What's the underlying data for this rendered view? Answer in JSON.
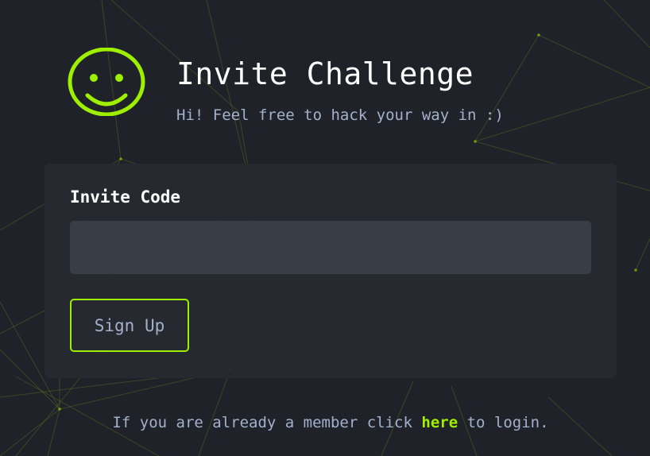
{
  "header": {
    "logo_icon": "smiley-face-icon",
    "title": "Invite Challenge",
    "subtitle": "Hi! Feel free to hack your way in :)"
  },
  "form": {
    "label": "Invite Code",
    "input_value": "",
    "input_placeholder": "",
    "submit_label": "Sign Up"
  },
  "footer": {
    "text_before": "If you are already a member click ",
    "link_text": "here",
    "text_after": " to login."
  },
  "theme": {
    "accent": "#9fef00",
    "background": "#1f2228",
    "card": "#262a30",
    "input": "#383e46",
    "muted_text": "#a4b1cd"
  }
}
